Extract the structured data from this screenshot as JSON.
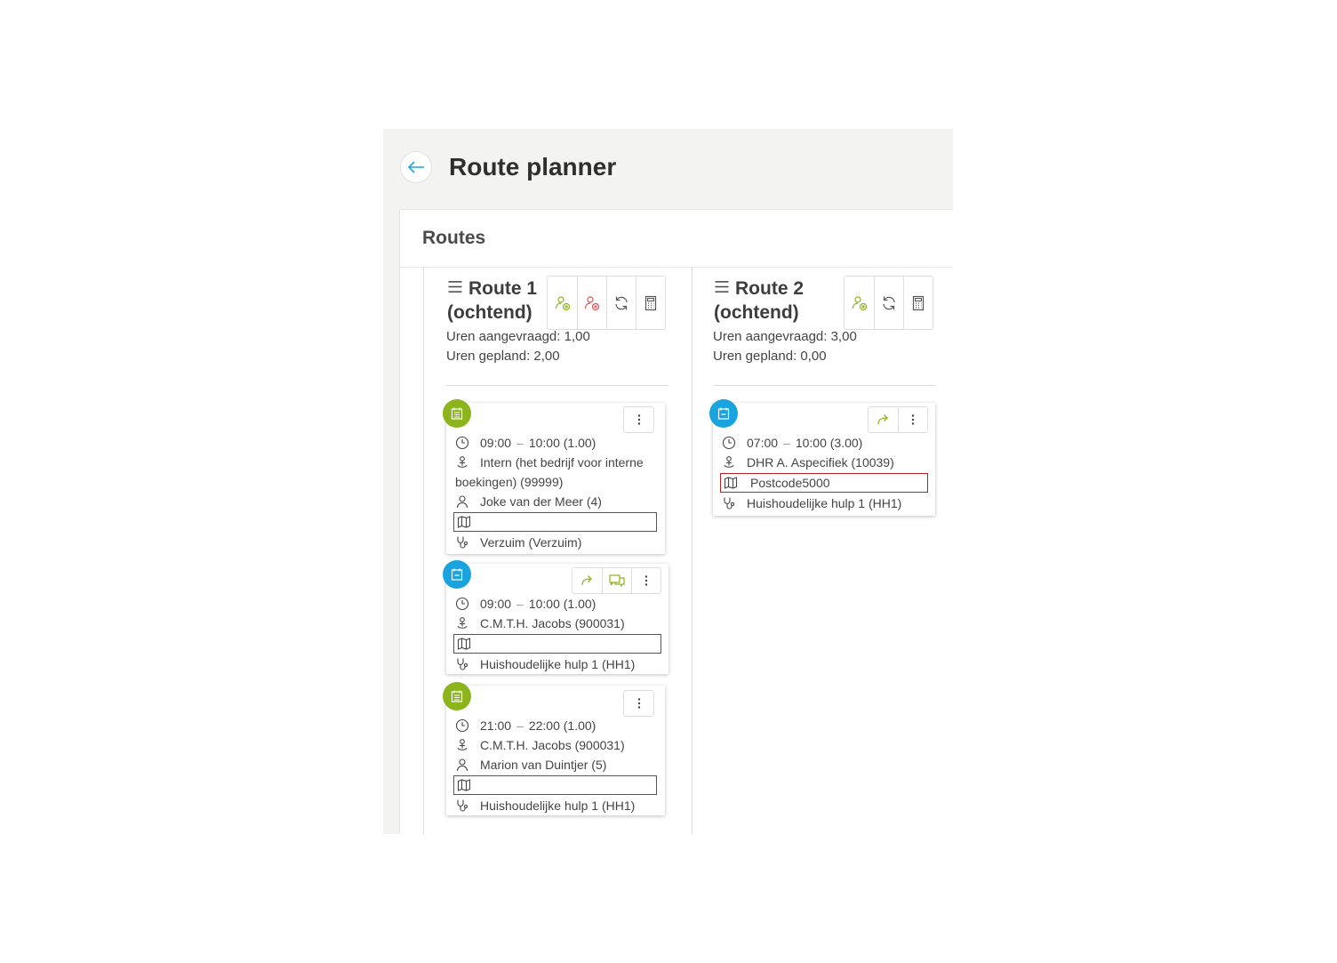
{
  "header": {
    "title": "Route planner"
  },
  "panel": {
    "title": "Routes"
  },
  "colors": {
    "accent": "#8cb41c",
    "primary": "#19a4df",
    "danger": "#e05555"
  },
  "routes": [
    {
      "title_line1": "Route 1",
      "title_line2": "(ochtend)",
      "hours_requested": "Uren aangevraagd: 1,00",
      "hours_planned": "Uren gepland: 2,00",
      "actions": [
        "add-person-icon",
        "remove-person-icon",
        "refresh-icon",
        "calculator-icon"
      ],
      "cards": [
        {
          "badge": "calendar-icon",
          "badge_color": "green",
          "time_start": "09:00",
          "time_sep": "–",
          "time_end": "10:00 (1.00)",
          "client": "Intern (het bedrijf voor interne boekingen) (99999)",
          "employee": "Joke van der Meer (4)",
          "address": "",
          "product": "Verzuim (Verzuim)"
        },
        {
          "badge": "minus-calendar-icon",
          "badge_color": "blue",
          "time_start": "09:00",
          "time_sep": "–",
          "time_end": "10:00 (1.00)",
          "client": "C.M.T.H. Jacobs (900031)",
          "address": "",
          "product": "Huishoudelijke hulp 1 (HH1)"
        },
        {
          "badge": "calendar-icon",
          "badge_color": "green",
          "time_start": "21:00",
          "time_sep": "–",
          "time_end": "22:00 (1.00)",
          "client": "C.M.T.H. Jacobs (900031)",
          "employee": "Marion van Duintjer (5)",
          "address": "",
          "product": "Huishoudelijke hulp 1 (HH1)"
        }
      ]
    },
    {
      "title_line1": "Route 2",
      "title_line2": "(ochtend)",
      "hours_requested": "Uren aangevraagd: 3,00",
      "hours_planned": "Uren gepland: 0,00",
      "actions": [
        "add-person-icon",
        "refresh-icon",
        "calculator-icon"
      ],
      "cards": [
        {
          "badge": "minus-calendar-icon",
          "badge_color": "blue",
          "time_start": "07:00",
          "time_sep": "–",
          "time_end": "10:00 (3.00)",
          "client": "DHR A. Aspecifiek (10039)",
          "address": "Postcode5000",
          "product": "Huishoudelijke hulp 1 (HH1)"
        }
      ]
    }
  ]
}
